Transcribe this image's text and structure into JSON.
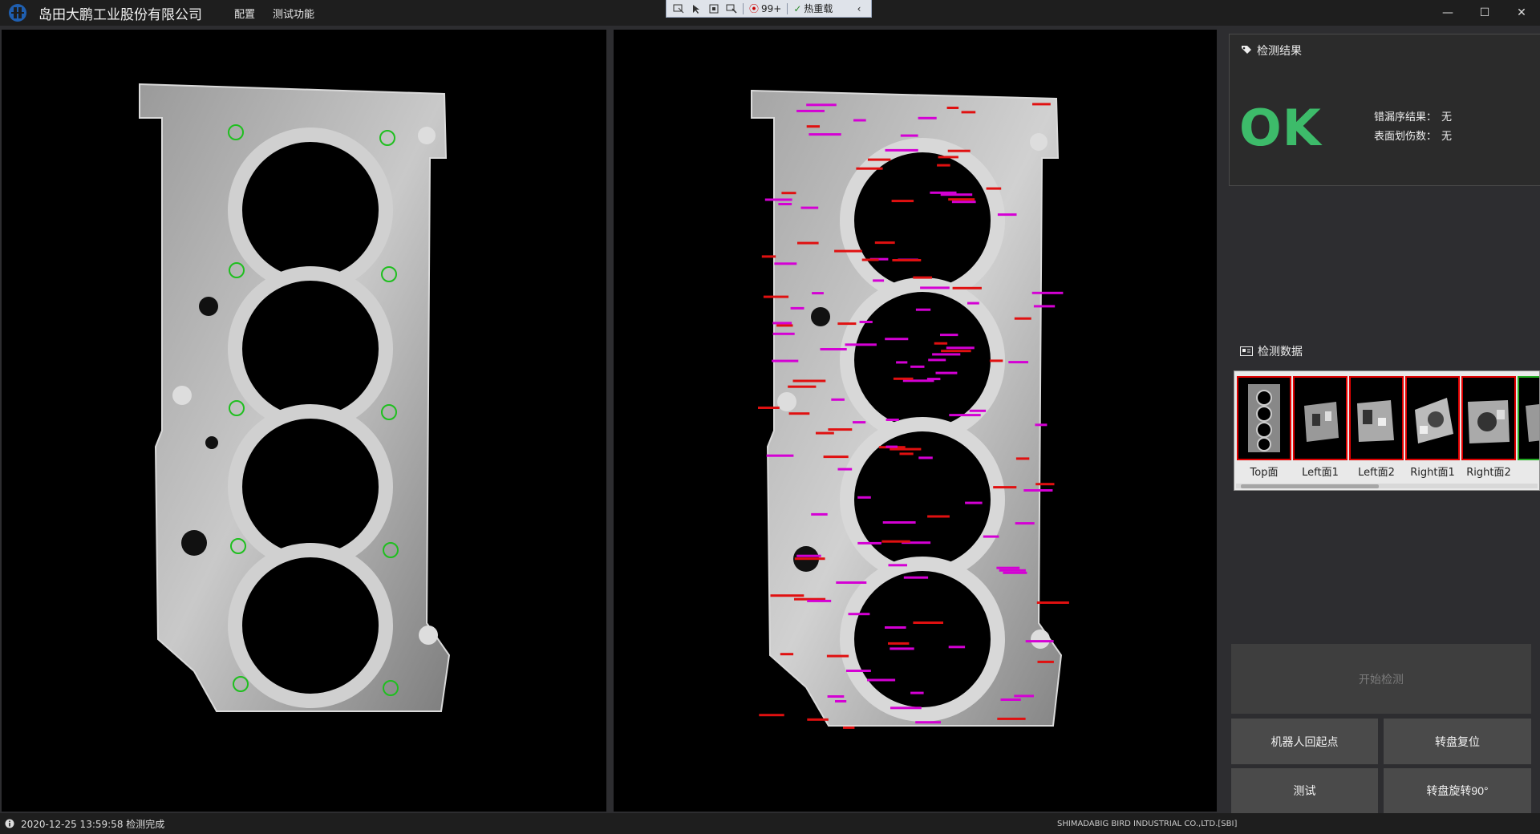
{
  "app": {
    "company": "岛田大鹏工业股份有限公司",
    "menu": [
      "配置",
      "测试功能"
    ]
  },
  "toolbar": {
    "badge_count": "99+",
    "hot_reload": "热重载"
  },
  "result": {
    "title": "检测结果",
    "status": "OK",
    "status_color": "#3dbb6a",
    "rows": [
      {
        "label": "错漏序结果：",
        "value": "无"
      },
      {
        "label": "表面划伤数：",
        "value": "无"
      }
    ]
  },
  "data_panel": {
    "title": "检测数据",
    "thumbs": [
      "Top面",
      "Left面1",
      "Left面2",
      "Right面1",
      "Right面2"
    ]
  },
  "buttons": {
    "start": "开始检测",
    "robot_home": "机器人回起点",
    "turntable_reset": "转盘复位",
    "test": "测试",
    "turntable_rotate": "转盘旋转90°"
  },
  "status": {
    "message": "2020-12-25 13:59:58 检测完成",
    "copyright": "SHIMADABIG BIRD INDUSTRIAL CO.,LTD.[SBI]"
  },
  "colors": {
    "accent_ok": "#3dbb6a",
    "thumb_border_fail": "#e00000",
    "thumb_border_pass": "#22aa22",
    "defect_marker": "#d400d4"
  }
}
